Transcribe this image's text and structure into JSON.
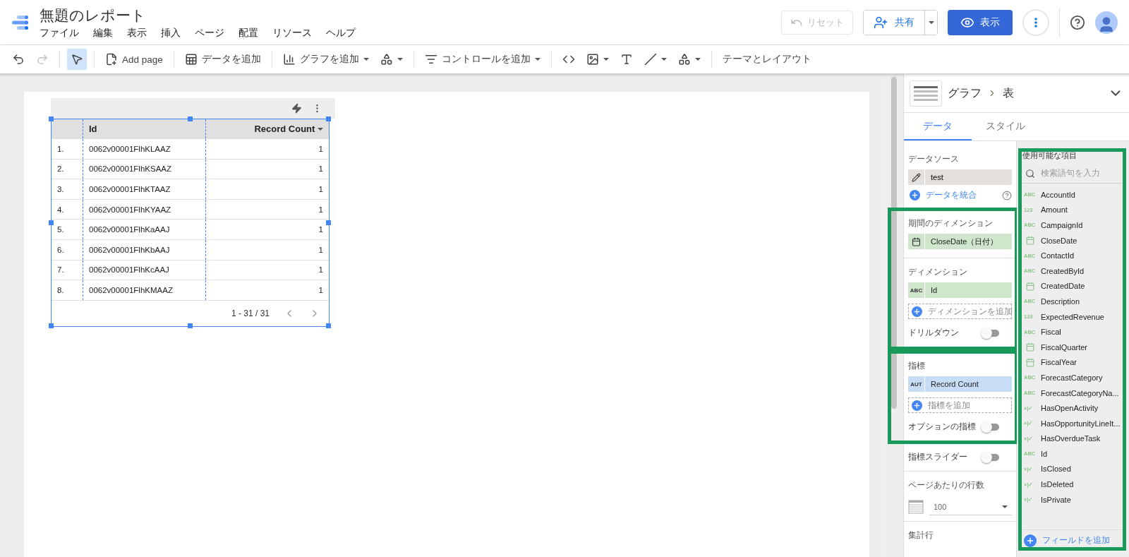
{
  "header": {
    "title": "無題のレポート",
    "menu": [
      "ファイル",
      "編集",
      "表示",
      "挿入",
      "ページ",
      "配置",
      "リソース",
      "ヘルプ"
    ],
    "reset": {
      "label": "リセット",
      "disabled": true
    },
    "share": {
      "label": "共有"
    },
    "view": {
      "label": "表示"
    }
  },
  "toolbar": [
    {
      "kind": "undo",
      "disabled": false
    },
    {
      "kind": "redo",
      "disabled": true
    },
    {
      "kind": "divider"
    },
    {
      "kind": "select",
      "selected": true
    },
    {
      "kind": "divider"
    },
    {
      "kind": "add-page",
      "label": "Add page"
    },
    {
      "kind": "divider"
    },
    {
      "kind": "add-data",
      "label": "データを追加"
    },
    {
      "kind": "divider"
    },
    {
      "kind": "add-chart",
      "label": "グラフを追加",
      "caret": true
    },
    {
      "kind": "components",
      "caret": true
    },
    {
      "kind": "divider"
    },
    {
      "kind": "add-control",
      "label": "コントロールを追加",
      "caret": true
    },
    {
      "kind": "divider"
    },
    {
      "kind": "code"
    },
    {
      "kind": "image",
      "caret": true
    },
    {
      "kind": "textbox"
    },
    {
      "kind": "line",
      "caret": true
    },
    {
      "kind": "shape",
      "caret": true
    },
    {
      "kind": "divider"
    },
    {
      "kind": "theme",
      "label": "テーマとレイアウト"
    }
  ],
  "table": {
    "columns": [
      "Id",
      "Record Count"
    ],
    "rows": [
      {
        "num": "1.",
        "id": "0062v00001FlhKLAAZ",
        "count": "1"
      },
      {
        "num": "2.",
        "id": "0062v00001FlhKSAAZ",
        "count": "1"
      },
      {
        "num": "3.",
        "id": "0062v00001FlhKTAAZ",
        "count": "1"
      },
      {
        "num": "4.",
        "id": "0062v00001FlhKYAAZ",
        "count": "1"
      },
      {
        "num": "5.",
        "id": "0062v00001FlhKaAAJ",
        "count": "1"
      },
      {
        "num": "6.",
        "id": "0062v00001FlhKbAAJ",
        "count": "1"
      },
      {
        "num": "7.",
        "id": "0062v00001FlhKcAAJ",
        "count": "1"
      },
      {
        "num": "8.",
        "id": "0062v00001FlhKMAAZ",
        "count": "1"
      }
    ],
    "pagination": "1 - 31 / 31",
    "selected": true
  },
  "panel": {
    "breadcrumb": [
      "グラフ",
      "表"
    ],
    "tabs": [
      {
        "label": "データ",
        "selected": true
      },
      {
        "label": "スタイル",
        "selected": false
      }
    ],
    "groups": [
      {
        "highlighted": false,
        "items": [
          {
            "kind": "heading",
            "text": "データソース"
          },
          {
            "kind": "source",
            "text": "test"
          },
          {
            "kind": "link",
            "text": "データを統合"
          }
        ]
      },
      {
        "highlighted": true,
        "items": [
          {
            "kind": "heading",
            "text": "期間のディメンション"
          },
          {
            "kind": "date-chip",
            "text": "CloseDate（日付）",
            "color": "#cfe6cc"
          },
          {
            "kind": "divider"
          },
          {
            "kind": "heading",
            "text": "ディメンション"
          },
          {
            "kind": "chip",
            "badge": "ABC",
            "text": "Id",
            "color": "#cfe6cc"
          },
          {
            "kind": "add",
            "text": "ディメンションを追加"
          },
          {
            "kind": "toggle",
            "text": "ドリルダウン",
            "on": false
          }
        ]
      },
      {
        "highlighted": true,
        "items": [
          {
            "kind": "heading",
            "text": "指標"
          },
          {
            "kind": "chip",
            "badge": "AUT",
            "text": "Record Count",
            "color": "#c6ddf5"
          },
          {
            "kind": "add",
            "text": "指標を追加"
          },
          {
            "kind": "toggle",
            "text": "オプションの指標",
            "on": false
          }
        ]
      },
      {
        "highlighted": false,
        "items": [
          {
            "kind": "toggle",
            "text": "指標スライダー",
            "on": false
          },
          {
            "kind": "divider"
          },
          {
            "kind": "heading",
            "text": "ページあたりの行数"
          },
          {
            "kind": "select",
            "text": "100"
          },
          {
            "kind": "divider"
          },
          {
            "kind": "heading",
            "text": "集計行"
          }
        ]
      }
    ],
    "fields": {
      "highlighted": true,
      "title": "使用可能な項目",
      "placeholder": "検索語句を入力",
      "add": "フィールドを追加",
      "items": [
        {
          "kind": "text",
          "badge": "ABC",
          "name": "AccountId"
        },
        {
          "kind": "number",
          "badge": "123",
          "name": "Amount"
        },
        {
          "kind": "text",
          "badge": "ABC",
          "name": "CampaignId"
        },
        {
          "kind": "date",
          "name": "CloseDate"
        },
        {
          "kind": "text",
          "badge": "ABC",
          "name": "ContactId"
        },
        {
          "kind": "text",
          "badge": "ABC",
          "name": "CreatedById"
        },
        {
          "kind": "date",
          "name": "CreatedDate"
        },
        {
          "kind": "text",
          "badge": "ABC",
          "name": "Description"
        },
        {
          "kind": "number",
          "badge": "123",
          "name": "ExpectedRevenue"
        },
        {
          "kind": "text",
          "badge": "ABC",
          "name": "Fiscal"
        },
        {
          "kind": "date",
          "name": "FiscalQuarter"
        },
        {
          "kind": "date",
          "name": "FiscalYear"
        },
        {
          "kind": "text",
          "badge": "ABC",
          "name": "ForecastCategory"
        },
        {
          "kind": "text",
          "badge": "ABC",
          "name": "ForecastCategoryNa..."
        },
        {
          "kind": "boolean",
          "badge": "×|✓",
          "name": "HasOpenActivity"
        },
        {
          "kind": "boolean",
          "badge": "×|✓",
          "name": "HasOpportunityLineIt..."
        },
        {
          "kind": "boolean",
          "badge": "×|✓",
          "name": "HasOverdueTask"
        },
        {
          "kind": "text",
          "badge": "ABC",
          "name": "Id"
        },
        {
          "kind": "boolean",
          "badge": "×|✓",
          "name": "IsClosed"
        },
        {
          "kind": "boolean",
          "badge": "×|✓",
          "name": "IsDeleted"
        },
        {
          "kind": "boolean",
          "badge": "×|✓",
          "name": "IsPrivate"
        }
      ]
    }
  }
}
